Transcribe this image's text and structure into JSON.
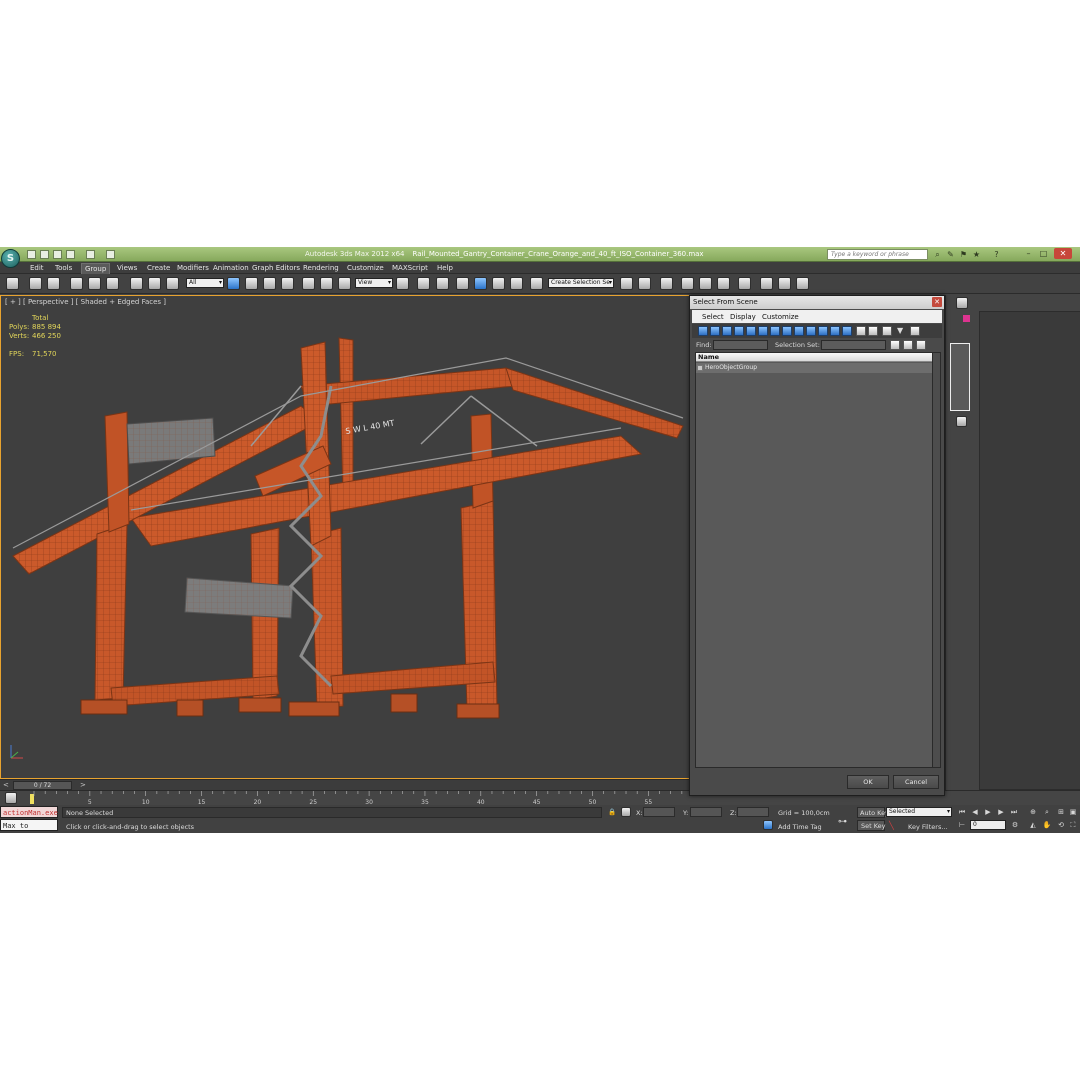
{
  "app": {
    "title_prefix": "Autodesk 3ds Max 2012 x64",
    "file_name": "Rail_Mounted_Gantry_Container_Crane_Orange_and_40_ft_ISO_Container_360.max",
    "search_placeholder": "Type a keyword or phrase"
  },
  "menus": [
    "Edit",
    "Tools",
    "Group",
    "Views",
    "Create",
    "Modifiers",
    "Animation",
    "Graph Editors",
    "Rendering",
    "Customize",
    "MAXScript",
    "Help"
  ],
  "toolbar": {
    "filter_value": "All",
    "ref_coord_value": "View",
    "selection_set_placeholder": "Create Selection Se"
  },
  "viewport": {
    "label": "[ + ] [ Perspective ] [ Shaded + Edged Faces ]",
    "stats": {
      "total_label": "Total",
      "polys_label": "Polys:",
      "polys_value": "885 894",
      "verts_label": "Verts:",
      "verts_value": "466 250",
      "fps_label": "FPS:",
      "fps_value": "71,570"
    },
    "crane_sign": "S W L  40 MT"
  },
  "timeline": {
    "frame_display": "0 / 72",
    "ticks": [
      5,
      10,
      15,
      20,
      25,
      30,
      35,
      40,
      45,
      50,
      55
    ]
  },
  "status": {
    "maxscript_line1": "actionMan.exe",
    "maxscript_line2": "Max to Physcs",
    "selection_text": "None Selected",
    "prompt_text": "Click or click-and-drag to select objects",
    "x_label": "X:",
    "y_label": "Y:",
    "z_label": "Z:",
    "grid_text": "Grid = 100,0cm",
    "add_time_tag": "Add Time Tag",
    "auto_key": "Auto Key",
    "set_key": "Set Key",
    "key_mode_value": "Selected",
    "key_filters": "Key Filters...",
    "frame_value": "0"
  },
  "dialog": {
    "title": "Select From Scene",
    "menu": [
      "Select",
      "Display",
      "Customize"
    ],
    "find_label": "Find:",
    "selection_set_label": "Selection Set:",
    "column_header": "Name",
    "items": [
      "HeroObjectGroup"
    ],
    "ok_label": "OK",
    "cancel_label": "Cancel"
  },
  "colors": {
    "crane_orange": "#c8582a",
    "viewport_bg": "#3f3f3f",
    "title_bar_green": "#97b86b",
    "active_viewport_border": "#e8a32f"
  }
}
